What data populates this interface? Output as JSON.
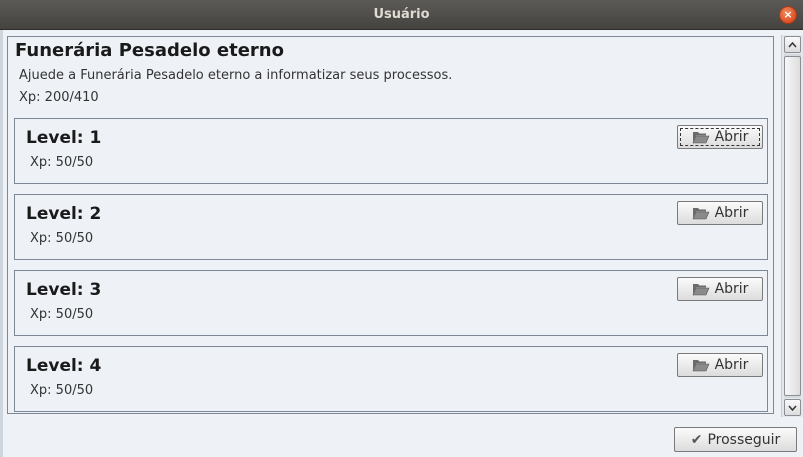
{
  "window": {
    "title": "Usuário"
  },
  "organization": {
    "name": "Funerária Pesadelo eterno",
    "description": "Ajuede a Funerária Pesadelo eterno a informatizar seus processos.",
    "xp": "Xp: 200/410"
  },
  "levels": [
    {
      "title": "Level: 1",
      "xp": "Xp: 50/50",
      "button": "Abrir"
    },
    {
      "title": "Level: 2",
      "xp": "Xp: 50/50",
      "button": "Abrir"
    },
    {
      "title": "Level: 3",
      "xp": "Xp: 50/50",
      "button": "Abrir"
    },
    {
      "title": "Level: 4",
      "xp": "Xp: 50/50",
      "button": "Abrir"
    }
  ],
  "footer": {
    "proceed_label": "Prosseguir"
  },
  "icons": {
    "close": "close-icon",
    "open": "folder-open-icon",
    "proceed": "check-icon"
  },
  "colors": {
    "titlebar": "#4f4e4a",
    "close": "#e0572a",
    "background": "#eef2f7"
  }
}
